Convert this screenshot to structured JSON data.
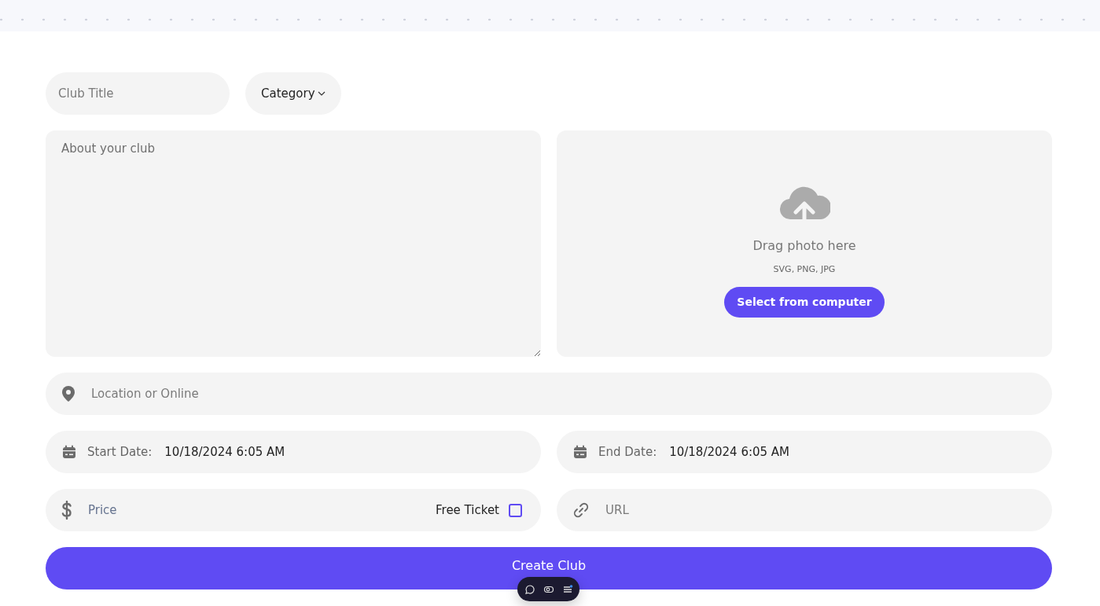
{
  "form": {
    "title_field": {
      "placeholder": "Club Title"
    },
    "category": {
      "label": "Category"
    },
    "about": {
      "placeholder": "About your club"
    },
    "upload": {
      "hint": "Drag photo here",
      "formats": "SVG, PNG, JPG",
      "button": "Select from computer"
    },
    "location": {
      "placeholder": "Location or Online"
    },
    "start_date": {
      "label": "Start Date:",
      "value": "10/18/2024 6:05 AM"
    },
    "end_date": {
      "label": "End Date:",
      "value": "10/18/2024 6:05 AM"
    },
    "price": {
      "placeholder": "Price"
    },
    "free_ticket": {
      "label": "Free Ticket",
      "checked": false
    },
    "url": {
      "placeholder": "URL"
    },
    "submit": "Create Club"
  }
}
